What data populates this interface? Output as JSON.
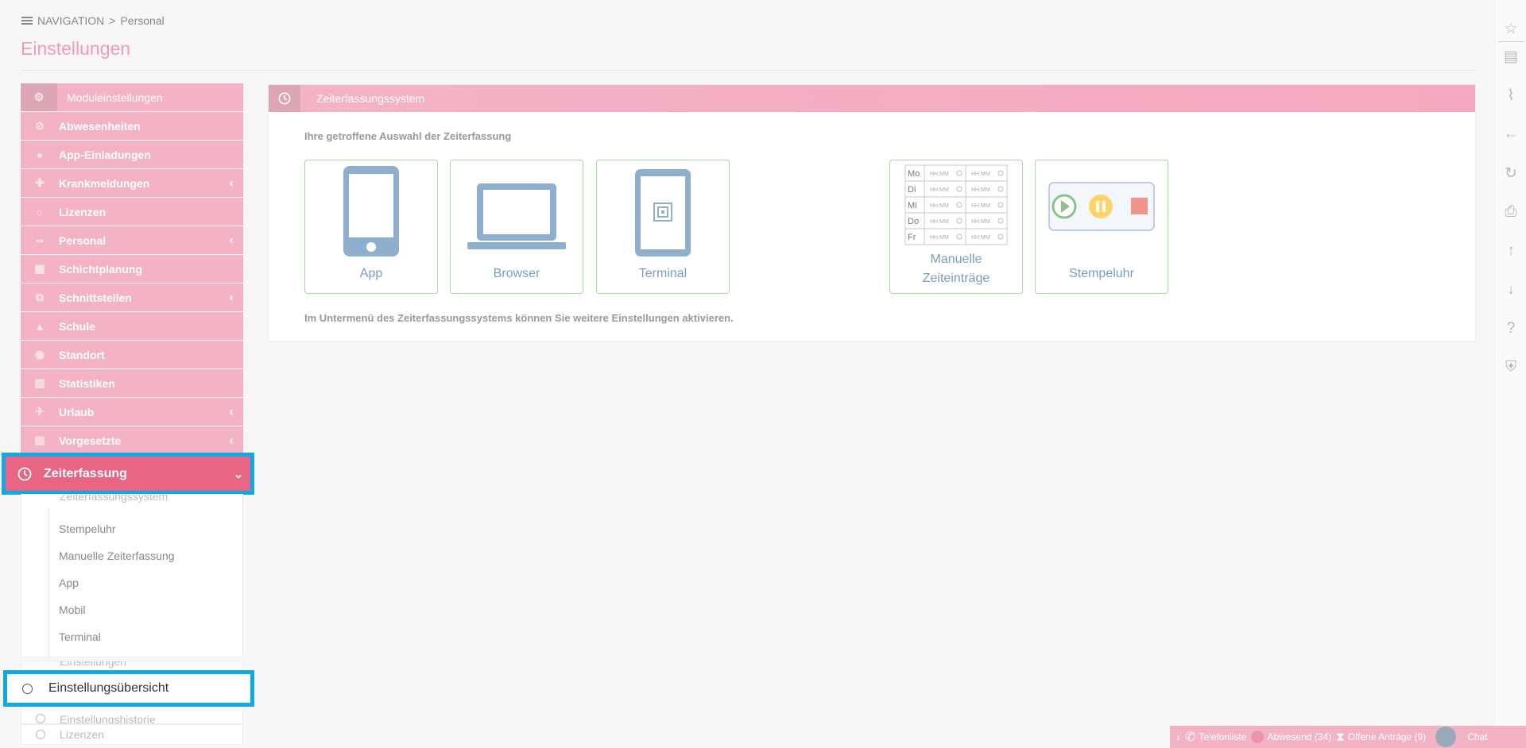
{
  "breadcrumb": {
    "nav": "NAVIGATION",
    "separator": ">",
    "current": "Personal"
  },
  "page_title": "Einstellungen",
  "sidebar": {
    "header": "Moduleinstellungen",
    "items": [
      {
        "label": "Abwesenheiten",
        "icon": "slash-circle-icon",
        "chevron": false
      },
      {
        "label": "App-Einladungen",
        "icon": "user-icon",
        "chevron": false
      },
      {
        "label": "Krankmeldungen",
        "icon": "medical-icon",
        "chevron": true
      },
      {
        "label": "Lizenzen",
        "icon": "circle-icon",
        "chevron": false
      },
      {
        "label": "Personal",
        "icon": "group-icon",
        "chevron": true
      },
      {
        "label": "Schichtplanung",
        "icon": "calendar-icon",
        "chevron": false
      },
      {
        "label": "Schnittstellen",
        "icon": "network-icon",
        "chevron": true
      },
      {
        "label": "Schule",
        "icon": "graduation-icon",
        "chevron": false
      },
      {
        "label": "Standort",
        "icon": "pin-icon",
        "chevron": false
      },
      {
        "label": "Statistiken",
        "icon": "chart-icon",
        "chevron": false
      },
      {
        "label": "Urlaub",
        "icon": "plane-icon",
        "chevron": true
      },
      {
        "label": "Vorgesetzte",
        "icon": "chart-icon",
        "chevron": true
      }
    ],
    "active": {
      "label": "Zeiterfassung",
      "chevron": "⌄"
    },
    "submenu_partial": "Zeiterfassungssystem",
    "submenu": [
      "Stempeluhr",
      "Manuelle Zeiterfassung",
      "App",
      "Mobil",
      "Terminal"
    ],
    "einstellungen_partial": "Einstellungen",
    "overview": "Einstellungsübersicht",
    "history": "Einstellungshistorie",
    "licenses": "Lizenzen"
  },
  "panel": {
    "title": "Zeiterfassungssystem",
    "intro": "Ihre getroffene Auswahl der Zeiterfassung",
    "footer": "Im Untermenü des Zeiterfassungssystems können Sie weitere Einstellungen aktivieren.",
    "cards": [
      {
        "label": "App",
        "icon": "smartphone-icon"
      },
      {
        "label": "Browser",
        "icon": "laptop-icon"
      },
      {
        "label": "Terminal",
        "icon": "terminal-icon"
      },
      {
        "label": "Manuelle\nZeiteinträge",
        "line1": "Manuelle",
        "line2": "Zeiteinträge",
        "icon": "timesheet-icon"
      },
      {
        "label": "Stempeluhr",
        "icon": "stopwatch-controls-icon"
      }
    ],
    "timesheet_days": [
      "Mo",
      "Di",
      "Mi",
      "Do",
      "Fr"
    ],
    "timesheet_placeholder": "HH:MM"
  },
  "bottom_bar": {
    "telefonliste": "Telefonliste",
    "abwesend": "Abwesend (34)",
    "antraege": "Offene Anträge (9)",
    "chat": "Chat"
  },
  "colors": {
    "accent": "#e86683",
    "menu": "#f4b3c5",
    "highlight": "#10a9e4",
    "card_border": "#a8d6a0",
    "icon_blue": "#8fafcf"
  }
}
